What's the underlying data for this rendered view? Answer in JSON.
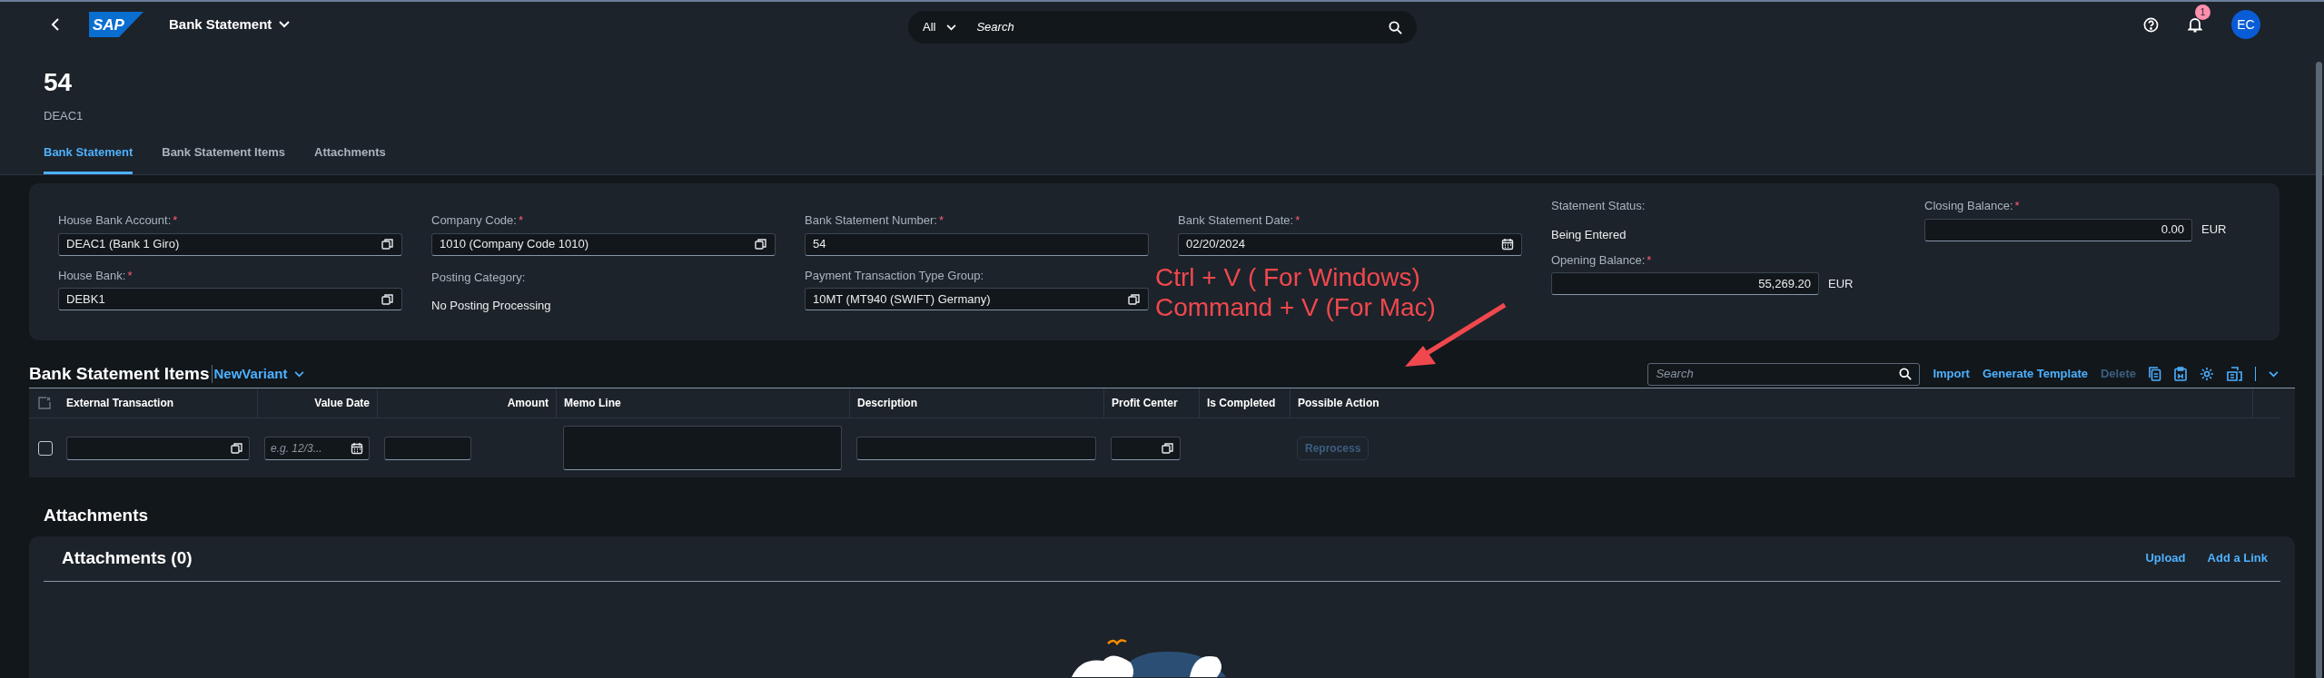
{
  "shell": {
    "logo": "SAP",
    "app_title": "Bank Statement",
    "search": {
      "scope": "All",
      "placeholder": "Search"
    },
    "notifications": {
      "badge": "1"
    },
    "avatar": "EC"
  },
  "header": {
    "title": "54",
    "subtitle": "DEAC1"
  },
  "tabs": [
    {
      "label": "Bank Statement",
      "selected": true
    },
    {
      "label": "Bank Statement Items",
      "selected": false
    },
    {
      "label": "Attachments",
      "selected": false
    }
  ],
  "form": {
    "columns": [
      [
        {
          "kind": "valuehelp",
          "label": "House Bank Account:",
          "required_mark": "*",
          "value": "DEAC1 (Bank 1 Giro)"
        },
        {
          "kind": "valuehelp",
          "label": "House Bank:",
          "required_mark": "*",
          "value": "DEBK1"
        }
      ],
      [
        {
          "kind": "valuehelp",
          "label": "Company Code:",
          "required_mark": "*",
          "value": "1010 (Company Code 1010)"
        },
        {
          "kind": "text",
          "label": "Posting Category:",
          "value": "No Posting Processing"
        }
      ],
      [
        {
          "kind": "input",
          "label": "Bank Statement Number:",
          "required_mark": "*",
          "value": "54"
        },
        {
          "kind": "valuehelp",
          "label": "Payment Transaction Type Group:",
          "value": "10MT (MT940 (SWIFT) Germany)"
        }
      ],
      [
        {
          "kind": "date",
          "label": "Bank Statement Date:",
          "required_mark": "*",
          "value": "02/20/2024"
        }
      ],
      [
        {
          "kind": "text",
          "label": "Statement Status:",
          "value": "Being Entered"
        },
        {
          "kind": "amount",
          "label": "Opening Balance:",
          "required_mark": "*",
          "value": "55,269.20",
          "unit": "EUR"
        }
      ],
      [
        {
          "kind": "amount",
          "label": "Closing Balance:",
          "required_mark": "*",
          "value": "0.00",
          "unit": "EUR"
        }
      ]
    ]
  },
  "annotation": {
    "lines": [
      "Ctrl + V ( For Windows)",
      "Command + V (For Mac)"
    ]
  },
  "items": {
    "title": "Bank Statement Items",
    "variant": "NewVariant",
    "search_placeholder": "Search",
    "actions": [
      {
        "label": "Import",
        "disabled": false
      },
      {
        "label": "Generate Template",
        "disabled": false
      },
      {
        "label": "Delete",
        "disabled": true
      }
    ],
    "columns": [
      "External Transaction",
      "Value Date",
      "Amount",
      "Memo Line",
      "Description",
      "Profit Center",
      "Is Completed",
      "Possible Action"
    ],
    "rows": [
      {
        "checked": false,
        "cells": [
          {
            "kind": "valuehelp"
          },
          {
            "kind": "date",
            "placeholder": "e.g. 12/3..."
          },
          {
            "kind": "input"
          },
          {
            "kind": "textarea"
          },
          {
            "kind": "input"
          },
          {
            "kind": "valuehelp"
          },
          {
            "kind": "empty"
          },
          {
            "kind": "button",
            "label": "Reprocess",
            "disabled": true
          }
        ]
      }
    ]
  },
  "attachments": {
    "section_title": "Attachments",
    "panel_title": "Attachments (0)",
    "actions": [
      "Upload",
      "Add a Link"
    ]
  }
}
